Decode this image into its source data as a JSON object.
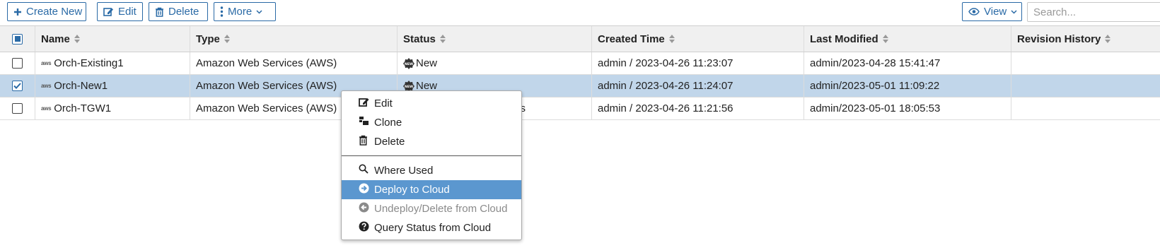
{
  "toolbar": {
    "create_label": "Create New",
    "edit_label": "Edit",
    "delete_label": "Delete",
    "more_label": "More",
    "view_label": "View",
    "search_placeholder": "Search..."
  },
  "table": {
    "columns": [
      "Name",
      "Type",
      "Status",
      "Created Time",
      "Last Modified",
      "Revision History"
    ],
    "rows": [
      {
        "name": "Orch-Existing1",
        "type": "Amazon Web Services (AWS)",
        "status": "New",
        "created": "admin / 2023-04-26 11:23:07",
        "modified": "admin/2023-04-28 15:41:47",
        "revision": "",
        "checked": false
      },
      {
        "name": "Orch-New1",
        "type": "Amazon Web Services (AWS)",
        "status": "New",
        "created": "admin / 2023-04-26 11:24:07",
        "modified": "admin/2023-05-01 11:09:22",
        "revision": "",
        "checked": true
      },
      {
        "name": "Orch-TGW1",
        "type": "Amazon Web Services (AWS)",
        "status": "s",
        "created": "admin / 2023-04-26 11:21:56",
        "modified": "admin/2023-05-01 18:05:53",
        "revision": "",
        "checked": false
      }
    ],
    "aws_icon_text": "aws",
    "status_badge_text": "NEW"
  },
  "context_menu": {
    "items": [
      {
        "label": "Edit",
        "icon": "edit-icon",
        "state": "normal"
      },
      {
        "label": "Clone",
        "icon": "clone-icon",
        "state": "normal"
      },
      {
        "label": "Delete",
        "icon": "trash-icon",
        "state": "normal"
      },
      {
        "label": "Where Used",
        "icon": "search-icon",
        "state": "normal"
      },
      {
        "label": "Deploy to Cloud",
        "icon": "arrow-right-circle-icon",
        "state": "active"
      },
      {
        "label": "Undeploy/Delete from Cloud",
        "icon": "arrow-left-circle-icon",
        "state": "disabled"
      },
      {
        "label": "Query Status from Cloud",
        "icon": "question-circle-icon",
        "state": "normal"
      }
    ]
  },
  "colors": {
    "accent": "#2a6aa6",
    "selected_row": "#c1d6ea",
    "menu_active": "#5b97cf"
  }
}
